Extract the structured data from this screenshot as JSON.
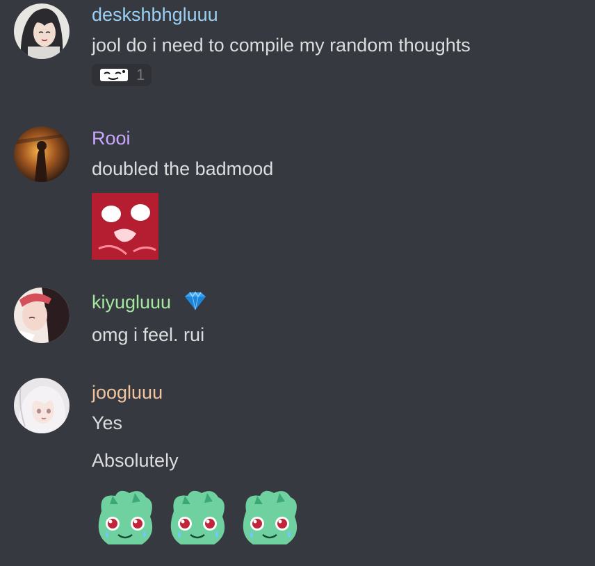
{
  "messages": [
    {
      "username": "deskshbhgluuu",
      "username_color": "#9ad0f5",
      "lines": [
        "jool do i need to compile my random thoughts"
      ],
      "reaction": {
        "icon": "sleepy-face-emoji-icon",
        "count": "1"
      }
    },
    {
      "username": "Rooi",
      "username_color": "#c9a7ff",
      "lines": [
        "doubled the badmood"
      ],
      "attachment": "shocked-anime-face-sticker"
    },
    {
      "username": "kiyugluuu",
      "username_color": "#a5e6a0",
      "badge": "diamond-badge-icon",
      "lines": [
        "omg i feel. rui"
      ]
    },
    {
      "username": "joogluuu",
      "username_color": "#f2c4a0",
      "lines": [
        "Yes",
        "Absolutely"
      ],
      "emojis": [
        "crying-bulbasaur-emoji",
        "crying-bulbasaur-emoji",
        "crying-bulbasaur-emoji"
      ]
    }
  ]
}
